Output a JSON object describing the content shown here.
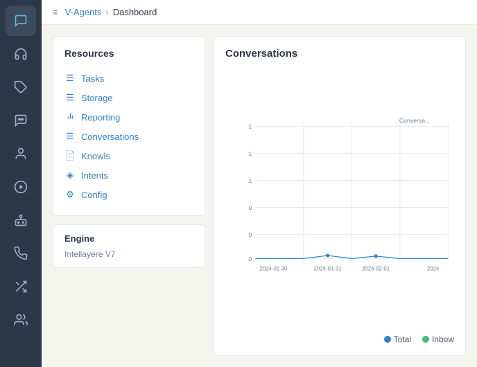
{
  "sidebar": {
    "icons": [
      {
        "name": "chat-bubble-icon",
        "symbol": "💬",
        "active": true
      },
      {
        "name": "headset-icon",
        "symbol": "🎧",
        "active": false
      },
      {
        "name": "tag-icon",
        "symbol": "🏷",
        "active": false
      },
      {
        "name": "comment-dots-icon",
        "symbol": "💭",
        "active": false
      },
      {
        "name": "user-circle-icon",
        "symbol": "👤",
        "active": false
      },
      {
        "name": "play-circle-icon",
        "symbol": "▶",
        "active": false
      },
      {
        "name": "robot-icon",
        "symbol": "🤖",
        "active": false
      },
      {
        "name": "phone-icon",
        "symbol": "📞",
        "active": false
      },
      {
        "name": "shuffle-icon",
        "symbol": "⇄",
        "active": false
      },
      {
        "name": "users-icon",
        "symbol": "👥",
        "active": false
      }
    ]
  },
  "breadcrumb": {
    "root": "V-Agents",
    "separator": "›",
    "current": "Dashboard",
    "menu_label": "≡"
  },
  "resources": {
    "title": "Resources",
    "items": [
      {
        "label": "Tasks",
        "icon": "☰",
        "name": "tasks-link"
      },
      {
        "label": "Storage",
        "icon": "☰",
        "name": "storage-link"
      },
      {
        "label": "Reporting",
        "icon": "📊",
        "name": "reporting-link"
      },
      {
        "label": "Conversations",
        "icon": "☰",
        "name": "conversations-link"
      },
      {
        "label": "Knowls",
        "icon": "📄",
        "name": "knowls-link"
      },
      {
        "label": "Intents",
        "icon": "◈",
        "name": "intents-link"
      },
      {
        "label": "Config",
        "icon": "⚙",
        "name": "config-link"
      }
    ]
  },
  "engine": {
    "title": "Engine",
    "version": "Intellayere V7"
  },
  "chart": {
    "title": "Conversations",
    "legend": {
      "total_label": "Total",
      "total_color": "#3182ce",
      "inbound_label": "Inbow",
      "inbound_color": "#48bb78"
    },
    "x_labels": [
      "2024-01-30",
      "2024-01-31",
      "2024-02-01",
      "2024"
    ],
    "y_labels": [
      "1",
      "1",
      "1",
      "0",
      "0",
      "0"
    ]
  }
}
